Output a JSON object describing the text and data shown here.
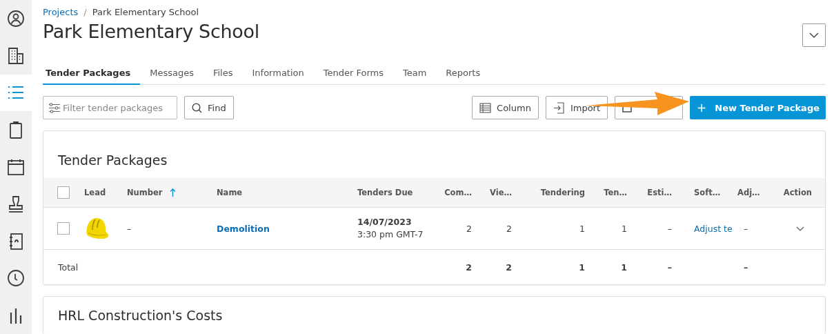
{
  "sidebar": {
    "items": [
      {
        "kind": "person",
        "selected": false
      },
      {
        "kind": "building",
        "selected": false
      },
      {
        "kind": "list",
        "selected": true
      },
      {
        "kind": "clipboard",
        "selected": false
      },
      {
        "kind": "calendar",
        "selected": false
      },
      {
        "kind": "stamp",
        "selected": false
      },
      {
        "kind": "contacts",
        "selected": false
      },
      {
        "kind": "clock",
        "selected": false
      },
      {
        "kind": "chart",
        "selected": false
      }
    ]
  },
  "breadcrumb": {
    "link": "Projects",
    "separator": "/",
    "current": "Park Elementary School"
  },
  "title": "Park Elementary School",
  "tabs": [
    {
      "label": "Tender Packages",
      "selected": true
    },
    {
      "label": "Messages",
      "selected": false
    },
    {
      "label": "Files",
      "selected": false
    },
    {
      "label": "Information",
      "selected": false
    },
    {
      "label": "Tender Forms",
      "selected": false
    },
    {
      "label": "Team",
      "selected": false
    },
    {
      "label": "Reports",
      "selected": false
    }
  ],
  "toolbar": {
    "filter": {
      "placeholder": "Filter tender packages"
    },
    "find": "Find",
    "buttons": [
      {
        "kind": "column",
        "label": "Column"
      },
      {
        "kind": "import",
        "label": "Import"
      },
      {
        "kind": "export"
      }
    ],
    "primary": {
      "icon": "+",
      "label": "New Tender Package"
    }
  },
  "table": {
    "title": "Tender Packages",
    "all_checked": false,
    "columns": [
      {
        "label": "Lead"
      },
      {
        "label": "Number",
        "sorted": true
      },
      {
        "label": "Name"
      },
      {
        "label": "Tenders Due"
      },
      {
        "label": "Com…"
      },
      {
        "label": "Vie…"
      },
      {
        "label": "Tendering"
      },
      {
        "label": "Ten…"
      },
      {
        "label": "Esti…"
      },
      {
        "label": "Soft…"
      },
      {
        "label": "Adj…"
      },
      {
        "label": "Action"
      }
    ],
    "rows": [
      {
        "checked": false,
        "number": "–",
        "name": "Demolition",
        "due_date": "14/07/2023",
        "due_time": "3:30 pm GMT-7",
        "values": [
          "2",
          "2",
          "1",
          "1",
          "–"
        ],
        "soft": "Adjust te",
        "adj": "–"
      }
    ],
    "total": {
      "label": "Total",
      "values": [
        "2",
        "2",
        "1",
        "1",
        "–"
      ],
      "adj": "–"
    }
  },
  "second_card": {
    "title": "HRL Construction's Costs"
  }
}
